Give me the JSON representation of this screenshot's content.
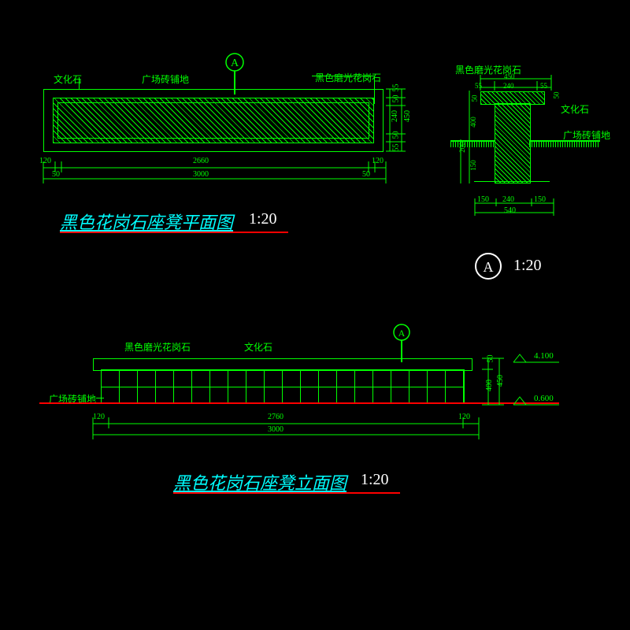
{
  "plan": {
    "labels": {
      "culture_stone": "文化石",
      "paving": "广场砖铺地",
      "polished": "黑色磨光花岗石"
    },
    "dims_h": [
      "120",
      "50",
      "2660",
      "50",
      "120",
      "3000"
    ],
    "dims_v": [
      "55",
      "50",
      "240",
      "50",
      "55",
      "450"
    ],
    "title": "黑色花岗石座凳平面图",
    "scale": "1:20",
    "marker": "A"
  },
  "section": {
    "labels": {
      "polished": "黑色磨光花岗石",
      "culture_stone": "文化石",
      "paving": "广场砖铺地"
    },
    "dims_top": [
      "55",
      "240",
      "55",
      "450",
      "50",
      "50"
    ],
    "dims_side": [
      "400",
      "50"
    ],
    "dims_bot": [
      "150",
      "240",
      "150",
      "540"
    ],
    "dims_left": [
      "150",
      "200"
    ],
    "marker": "A",
    "scale": "1:20"
  },
  "elevation": {
    "labels": {
      "polished": "黑色磨光花岗石",
      "culture_stone": "文化石",
      "paving": "广场砖铺地"
    },
    "dims_h": [
      "120",
      "2760",
      "120",
      "3000"
    ],
    "dims_v": [
      "50",
      "400",
      "450"
    ],
    "elev_top": "4.100",
    "elev_bot": "0.600",
    "marker": "A",
    "title": "黑色花岗石座凳立面图",
    "scale": "1:20"
  }
}
